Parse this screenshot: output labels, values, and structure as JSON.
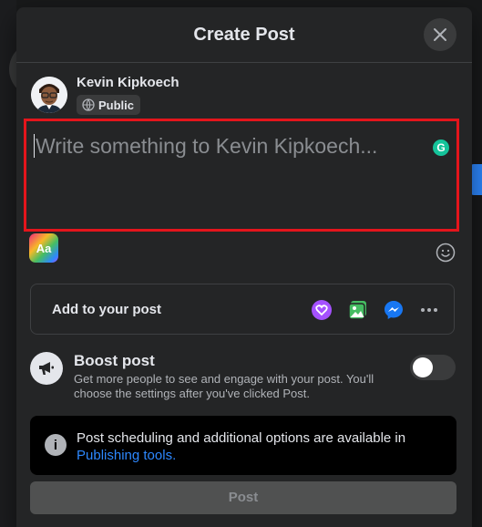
{
  "dialog": {
    "title": "Create Post",
    "close_icon": "close-icon"
  },
  "user": {
    "name": "Kevin Kipkoech",
    "privacy": "Public",
    "privacy_icon": "globe-icon"
  },
  "composer": {
    "placeholder": "Write something to Kevin Kipkoech...",
    "value": "",
    "grammarly_icon": "grammarly-icon"
  },
  "tools": {
    "background_picker_label": "Aa",
    "emoji_icon": "smiley-icon"
  },
  "add_to_post": {
    "label": "Add to your post",
    "icons": [
      "support-heart-icon",
      "photo-icon",
      "messenger-icon",
      "more-icon"
    ]
  },
  "boost": {
    "title": "Boost post",
    "description": "Get more people to see and engage with your post. You'll choose the settings after you've clicked Post.",
    "enabled": false,
    "icon": "megaphone-icon"
  },
  "info": {
    "text": "Post scheduling and additional options are available in",
    "link": "Publishing tools."
  },
  "actions": {
    "post_label": "Post"
  },
  "colors": {
    "accent": "#2d88ff",
    "highlight_border": "#e4151c",
    "modal_bg": "#242526"
  }
}
